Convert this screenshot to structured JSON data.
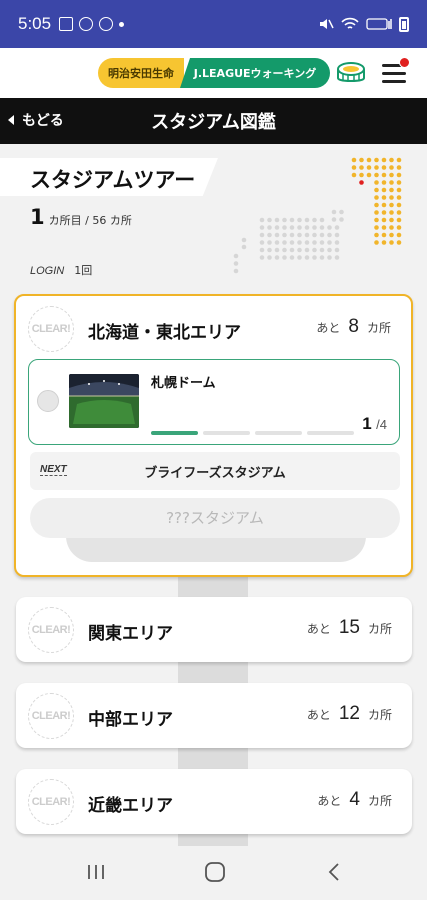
{
  "status_bar": {
    "time": "5:05"
  },
  "header": {
    "brand_left": "明治安田生命",
    "brand_right": "J.LEAGUEウォーキング",
    "icons": [
      "stadium-icon",
      "menu-icon"
    ]
  },
  "nav": {
    "back_label": "もどる",
    "title": "スタジアム図鑑"
  },
  "tour": {
    "title": "スタジアムツアー",
    "count": "1",
    "count_unit": "カ所目 / 56 カ所",
    "login_label": "LOGIN",
    "login_count": "1回"
  },
  "areas": [
    {
      "clear_label": "CLEAR!",
      "name": "北海道・東北エリア",
      "remaining_pre": "あと",
      "remaining": "8",
      "remaining_unit": "カ所",
      "current_stadium": {
        "name": "札幌ドーム",
        "progress_current": "1",
        "progress_total": "/4",
        "progress_value": 0.25
      },
      "next_label": "NEXT",
      "next_stadium": "ブライフーズスタジアム",
      "unknown_stadium": "???スタジアム"
    },
    {
      "clear_label": "CLEAR!",
      "name": "関東エリア",
      "remaining_pre": "あと",
      "remaining": "15",
      "remaining_unit": "カ所"
    },
    {
      "clear_label": "CLEAR!",
      "name": "中部エリア",
      "remaining_pre": "あと",
      "remaining": "12",
      "remaining_unit": "カ所"
    },
    {
      "clear_label": "CLEAR!",
      "name": "近畿エリア",
      "remaining_pre": "あと",
      "remaining": "4",
      "remaining_unit": "カ所"
    }
  ],
  "colors": {
    "accent_yellow": "#f0b428",
    "accent_green": "#3aa57a",
    "status_bar": "#3b46a8"
  }
}
